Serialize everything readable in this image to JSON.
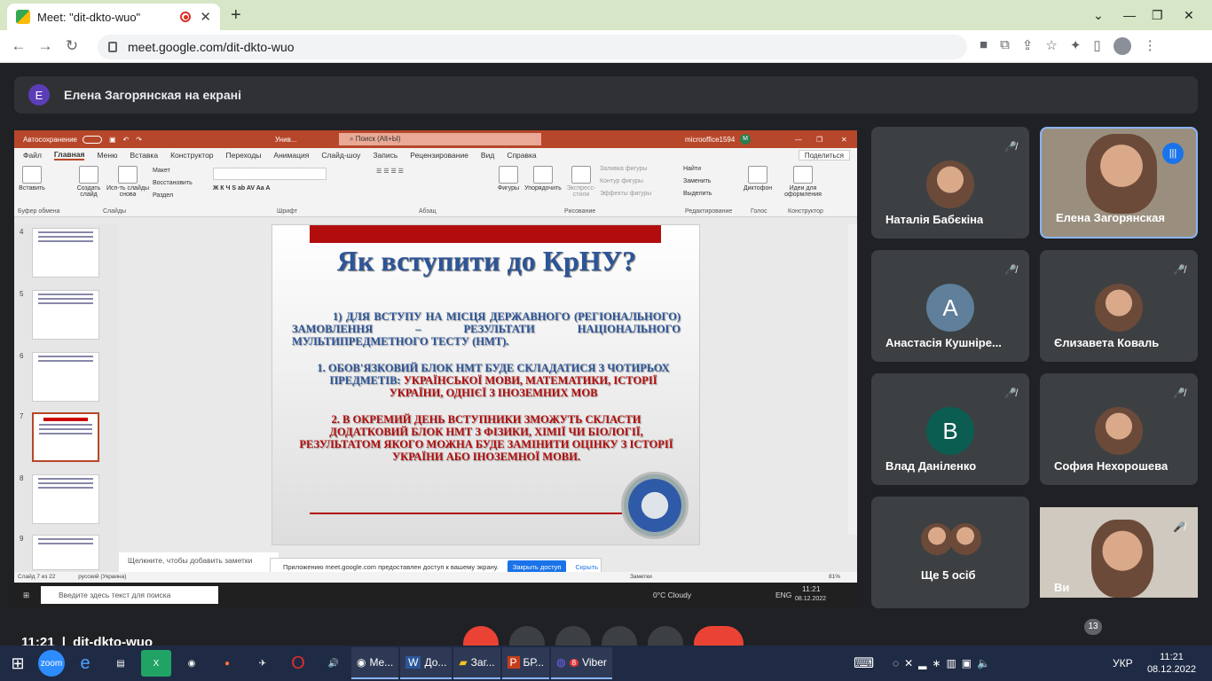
{
  "browser": {
    "tab_title": "Meet: \"dit-dkto-wuo\"",
    "url": "meet.google.com/dit-dkto-wuo"
  },
  "meet": {
    "presenter_initial": "E",
    "presenter_text": "Елена Загорянская на екрані",
    "meeting_code": "dit-dkto-wuo",
    "time": "11:21",
    "participants_count": "13",
    "tiles": [
      {
        "name": "Наталія Бабєкіна",
        "type": "photo"
      },
      {
        "name": "Елена Загорянская",
        "type": "photo"
      },
      {
        "name": "Анастасія Кушніре...",
        "initial": "A",
        "color": "#5f7f9a"
      },
      {
        "name": "Єлизавета Коваль",
        "type": "photo"
      },
      {
        "name": "Влад Даніленко",
        "initial": "B",
        "color": "#0b5d52"
      },
      {
        "name": "София Нехорошева",
        "type": "photo"
      },
      {
        "name": "Ще 5 осіб",
        "type": "group"
      },
      {
        "name": "Ви",
        "type": "photo"
      }
    ]
  },
  "ppt": {
    "autosave": "Автосохранение",
    "filename": "Унив...",
    "search": "Поиск (Alt+Ы)",
    "account": "microoffice1594",
    "account_initial": "M",
    "menu": [
      "Файл",
      "Главная",
      "Меню",
      "Вставка",
      "Конструктор",
      "Переходы",
      "Анимация",
      "Слайд-шоу",
      "Запись",
      "Рецензирование",
      "Вид",
      "Справка"
    ],
    "share": "Поделиться",
    "ribbon": {
      "paste": "Вставить",
      "create_slide": "Создать слайд",
      "reuse": "Исп-ть слайды снова",
      "layout": "Макет",
      "reset": "Восстановить",
      "sections": "Раздел",
      "shapes": "Фигуры",
      "arrange": "Упорядочить",
      "styles": "Экспресс-стили",
      "fill": "Заливка фигуры",
      "outline": "Контур фигуры",
      "effects": "Эффекты фигуры",
      "find": "Найти",
      "replace": "Заменить",
      "select": "Выделить",
      "dictate": "Диктофон",
      "designer": "Идеи для оформления",
      "groups": [
        "Буфер обмена",
        "Слайды",
        "Шрифт",
        "Абзац",
        "Рисование",
        "Редактирование",
        "Голос",
        "Конструктор"
      ]
    },
    "thumb_numbers": [
      "4",
      "5",
      "6",
      "7",
      "8",
      "9"
    ],
    "slide": {
      "title": "Як вступити до КрНУ?",
      "p1": "1) ДЛЯ ВСТУПУ НА МІСЦЯ ДЕРЖАВНОГО (РЕГІОНАЛЬНОГО) ЗАМОВЛЕННЯ – РЕЗУЛЬТАТИ НАЦІОНАЛЬНОГО МУЛЬТИПРЕДМЕТНОГО ТЕСТУ (НМТ).",
      "p2a": "1.   ОБОВ'ЯЗКОВИЙ БЛОК НМТ БУДЕ СКЛАДАТИСЯ З ЧОТИРЬОХ ПРЕДМЕТІВ: ",
      "p2b": "УКРАЇНСЬКОЇ МОВИ, МАТЕМАТИКИ, ІСТОРІЇ УКРАЇНИ, ОДНІЄЇ З ІНОЗЕМНИХ МОВ",
      "p3": "2. В ОКРЕМИЙ ДЕНЬ ВСТУПНИКИ ЗМОЖУТЬ СКЛАСТИ ДОДАТКОВИЙ БЛОК НМТ З ФІЗИКИ, ХІМІЇ ЧИ БІОЛОГІЇ, РЕЗУЛЬТАТОМ ЯКОГО МОЖНА БУДЕ ЗАМІНИТИ ОЦІНКУ З ІСТОРІЇ УКРАЇНИ АБО ІНОЗЕМНОЇ МОВИ."
    },
    "notes": "Щелкните, чтобы добавить заметки",
    "share_notice": "Приложению meet.google.com предоставлен доступ к вашему экрану.",
    "stop_share": "Закрыть доступ",
    "hide": "Скрыть",
    "status_slide": "Слайд 7 из 22",
    "status_lang": "русский (Украина)",
    "status_notes": "Заметки",
    "zoom": "81%",
    "inner_search": "Введите здесь текст для поиска",
    "weather": "0°C  Cloudy",
    "inner_lang": "ENG",
    "inner_time": "11:21",
    "inner_date": "08.12.2022"
  },
  "taskbar": {
    "apps": [
      "Me...",
      "До...",
      "Заг...",
      "БР...",
      "Viber"
    ],
    "viber_badge": "8",
    "lang": "УКР",
    "time": "11:21",
    "date": "08.12.2022"
  }
}
